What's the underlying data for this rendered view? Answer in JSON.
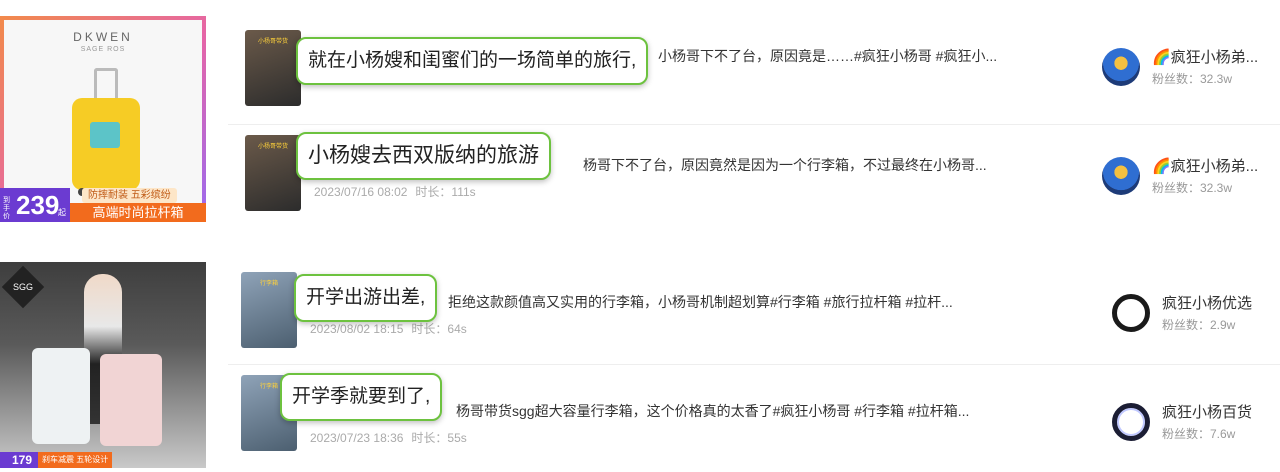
{
  "products": [
    {
      "brand": "DKWEN",
      "brand_sub": "SAGE ROS",
      "price_prefix": "到手价",
      "price": "239",
      "price_suffix": "起",
      "tag_top": "防摔耐装 五彩缤纷",
      "tag_bottom": "高端时尚拉杆箱"
    },
    {
      "logo": "SGG",
      "price": "179",
      "tag": "刹车减震 五轮设计"
    }
  ],
  "videos": [
    {
      "thumb_caption": "小杨哥带货",
      "popup": "就在小杨嫂和闺蜜们的一场简单的旅行,",
      "description": "小杨哥下不了台，原因竟是……#疯狂小杨哥 #疯狂小...",
      "date": "",
      "duration": "",
      "author": "🌈疯狂小杨弟...",
      "fans": "粉丝数：32.3w",
      "avatar_icon": "superhero-avatar-icon"
    },
    {
      "thumb_caption": "小杨哥带货",
      "popup": "小杨嫂去西双版纳的旅游",
      "description": "杨哥下不了台，原因竟然是因为一个行李箱，不过最终在小杨哥...",
      "date": "2023/07/16 08:02",
      "duration": "时长：111s",
      "author": "🌈疯狂小杨弟...",
      "fans": "粉丝数：32.3w",
      "avatar_icon": "superhero-avatar-icon"
    },
    {
      "thumb_caption": "行李箱",
      "popup": "开学出游出差,",
      "description": "拒绝这款颜值高又实用的行李箱，小杨哥机制超划算#行李箱 #旅行拉杆箱 #拉杆...",
      "date": "2023/08/02 18:15",
      "duration": "时长：64s",
      "author": "疯狂小杨优选",
      "fans": "粉丝数：2.9w",
      "avatar_icon": "ring-logo-avatar-icon"
    },
    {
      "thumb_caption": "行李箱",
      "popup": "开学季就要到了,",
      "description": "杨哥带货sgg超大容量行李箱，这个价格真的太香了#疯狂小杨哥 #行李箱 #拉杆箱...",
      "date": "2023/07/23 18:36",
      "duration": "时长：55s",
      "author": "疯狂小杨百货",
      "fans": "粉丝数：7.6w",
      "avatar_icon": "ring-logo-avatar-icon"
    }
  ]
}
